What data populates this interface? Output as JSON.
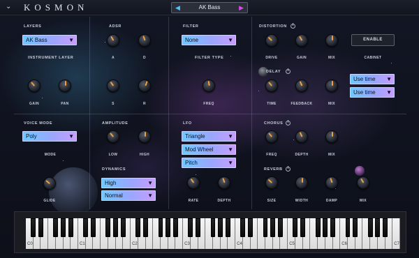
{
  "header": {
    "brand": "KOSMON",
    "preset": "AK Bass",
    "prev_icon": "triangle-left-icon",
    "next_icon": "triangle-right-icon"
  },
  "layers": {
    "title": "LAYERS",
    "instrument": "AK Bass",
    "instrument_label": "INSTRUMENT LAYER",
    "gain_label": "GAIN",
    "pan_label": "PAN"
  },
  "adsr": {
    "title": "ADSR",
    "a": "A",
    "d": "D",
    "s": "S",
    "r": "R"
  },
  "filter": {
    "title": "FILTER",
    "type": "None",
    "type_label": "FILTER TYPE",
    "freq_label": "FREQ"
  },
  "distortion": {
    "title": "DISTORTION",
    "drive": "DRIVE",
    "gain": "GAIN",
    "mix": "MIX",
    "enable": "ENABLE",
    "cabinet": "CABINET"
  },
  "delay": {
    "title": "DELAY",
    "time": "TIME",
    "feedback": "FEEDBACK",
    "mix": "MIX",
    "sync1": "Use time",
    "sync2": "Use time"
  },
  "voice": {
    "title": "VOICE MODE",
    "mode": "Poly",
    "mode_label": "MODE",
    "glide_label": "GLIDE"
  },
  "amplitude": {
    "title": "AMPLITUDE",
    "low": "LOW",
    "high": "HIGH"
  },
  "dynamics": {
    "title": "DYNAMICS",
    "level": "High",
    "curve": "Normal"
  },
  "lfo": {
    "title": "LFO",
    "shape": "Triangle",
    "source": "Mod Wheel",
    "target": "Pitch",
    "rate": "RATE",
    "depth": "DEPTH"
  },
  "chorus": {
    "title": "CHORUS",
    "freq": "FREQ",
    "depth": "DEPTH",
    "mix": "MIX"
  },
  "reverb": {
    "title": "REVERB",
    "size": "SIZE",
    "width": "WIDTH",
    "damp": "DAMP",
    "mix": "MIX"
  },
  "keyboard": {
    "octaves": [
      "C0",
      "C1",
      "C2",
      "C3",
      "C4",
      "C5",
      "C6",
      "C7"
    ]
  },
  "colors": {
    "knob_pointer": "#f0a040",
    "dropdown_left": "#6fc8ff",
    "dropdown_right": "#c99dff",
    "prev_arrow": "#4ec4ff",
    "next_arrow": "#d84be8"
  }
}
